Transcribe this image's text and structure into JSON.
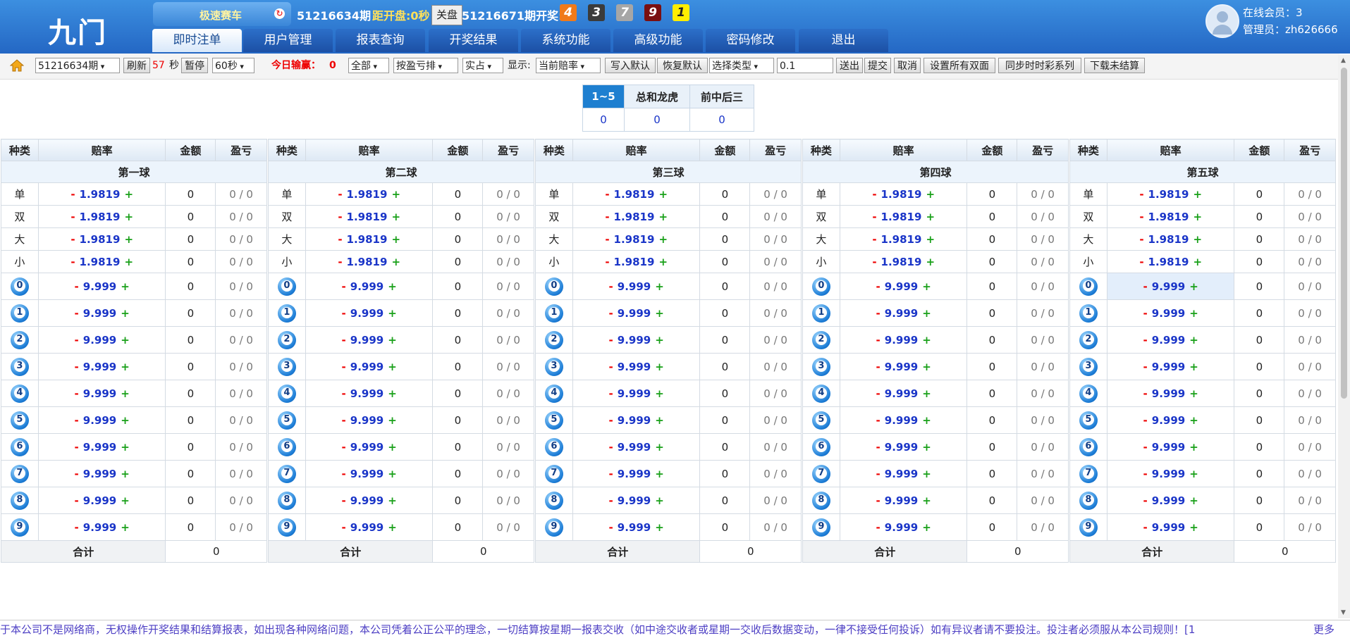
{
  "header": {
    "logo": "九门",
    "game_name": "极速赛车",
    "current_period": "51216634期",
    "countdown_label": "距开盘:0秒",
    "close_button": "关盘",
    "last_period": "51216671期开奖:",
    "results": [
      {
        "n": "4",
        "bg": "#f07a1a",
        "fg": "#fff"
      },
      {
        "n": "3",
        "bg": "#3b3b3b",
        "fg": "#fff"
      },
      {
        "n": "7",
        "bg": "#a6a6a6",
        "fg": "#fff"
      },
      {
        "n": "9",
        "bg": "#7a0f10",
        "fg": "#fff"
      },
      {
        "n": "1",
        "bg": "#ffee00",
        "fg": "#222"
      }
    ],
    "online_members": "在线会员：3",
    "admin": "管理员：zh626666",
    "nav": [
      "即时注单",
      "用户管理",
      "报表查询",
      "开奖结果",
      "系统功能",
      "高级功能",
      "密码修改",
      "退出"
    ]
  },
  "toolbar": {
    "period_select": "51216634期",
    "refresh": "刷新",
    "seconds": "57",
    "sec_unit": "秒",
    "pause": "暂停",
    "interval_select": "60秒",
    "today_label": "今日输赢：",
    "today_value": "0",
    "filter_all": "全部",
    "sort_select": "按盈亏排",
    "share_select": "实占",
    "display_label": "显示:",
    "rate_select": "当前赔率",
    "write_default": "写入默认",
    "restore_default": "恢复默认",
    "type_select": "选择类型",
    "step_value": "0.1",
    "send_out": "送出",
    "submit": "提交",
    "cancel": "取消",
    "set_all": "设置所有双面",
    "sync": "同步时时彩系列",
    "download": "下载未结算"
  },
  "tabs": {
    "headers": [
      "1~5",
      "总和龙虎",
      "前中后三"
    ],
    "values": [
      "0",
      "0",
      "0"
    ]
  },
  "grid": {
    "columns_header": [
      "种类",
      "赔率",
      "金额",
      "盈亏"
    ],
    "balls": [
      "第一球",
      "第二球",
      "第三球",
      "第四球",
      "第五球"
    ],
    "text_rows": [
      "单",
      "双",
      "大",
      "小"
    ],
    "text_odds": "1.9819",
    "num_rows": [
      "0",
      "1",
      "2",
      "3",
      "4",
      "5",
      "6",
      "7",
      "8",
      "9"
    ],
    "num_odds": "9.999",
    "minus": "-",
    "plus": "+",
    "amount": "0",
    "pl": "0 / 0",
    "total_label": "合计",
    "total_value": "0"
  },
  "footer": {
    "notice": "于本公司不是网络商，无权操作开奖结果和结算报表，如出现各种网络问题，本公司凭着公正公平的理念，一切结算按星期一报表交收（如中途交收者或星期一交收后数据变动，一律不接受任何投诉）如有异议者请不要投注。投注者必须服从本公司规则！[1",
    "more": "更多"
  }
}
